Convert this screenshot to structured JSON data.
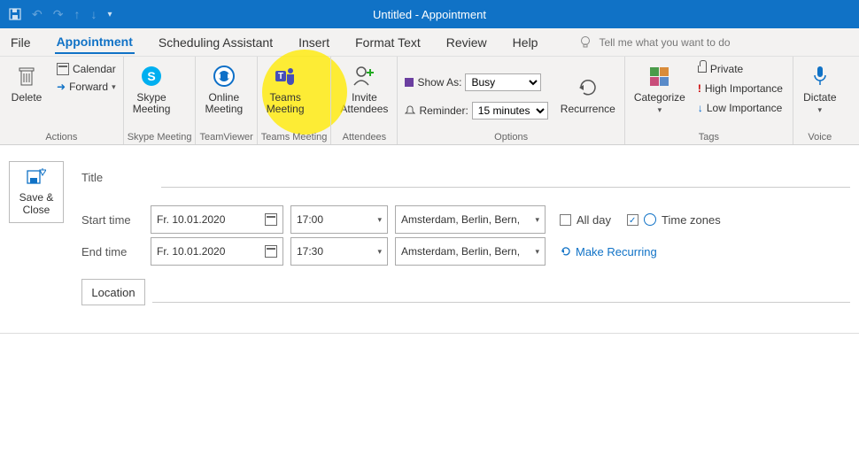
{
  "window": {
    "title": "Untitled  -  Appointment"
  },
  "tabs": {
    "file": "File",
    "appointment": "Appointment",
    "scheduling": "Scheduling Assistant",
    "insert": "Insert",
    "format": "Format Text",
    "review": "Review",
    "help": "Help",
    "tellme": "Tell me what you want to do"
  },
  "ribbon": {
    "actions": {
      "delete": "Delete",
      "calendar": "Calendar",
      "forward": "Forward",
      "group": "Actions"
    },
    "skype": {
      "label": "Skype\nMeeting",
      "group": "Skype Meeting"
    },
    "teamviewer": {
      "label": "Online\nMeeting",
      "group": "TeamViewer"
    },
    "teams": {
      "label": "Teams\nMeeting",
      "group": "Teams Meeting"
    },
    "attendees": {
      "invite": "Invite\nAttendees",
      "group": "Attendees"
    },
    "options": {
      "showas_label": "Show As:",
      "showas_value": "Busy",
      "reminder_label": "Reminder:",
      "reminder_value": "15 minutes",
      "recurrence": "Recurrence",
      "group": "Options"
    },
    "tags": {
      "categorize": "Categorize",
      "private": "Private",
      "high": "High Importance",
      "low": "Low Importance",
      "group": "Tags"
    },
    "voice": {
      "dictate": "Dictate",
      "group": "Voice"
    }
  },
  "form": {
    "saveclose": "Save &\nClose",
    "title_label": "Title",
    "start_label": "Start time",
    "end_label": "End time",
    "start_date": "Fr. 10.01.2020",
    "start_time": "17:00",
    "end_date": "Fr. 10.01.2020",
    "end_time": "17:30",
    "timezone": "Amsterdam, Berlin, Bern,",
    "allday": "All day",
    "timezones": "Time zones",
    "make_recurring": "Make Recurring",
    "location": "Location"
  }
}
